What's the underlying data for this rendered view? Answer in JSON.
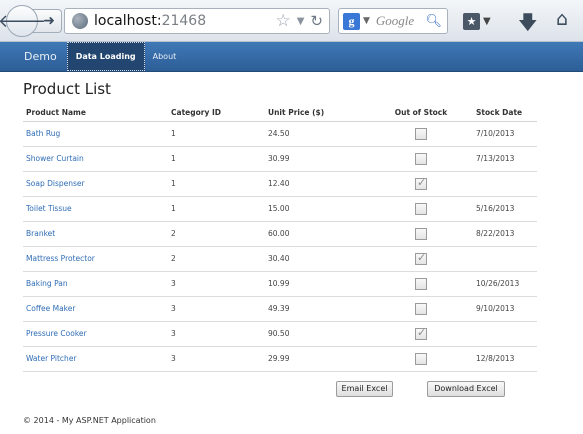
{
  "browser": {
    "url_host": "localhost:",
    "url_port": "21468",
    "search_placeholder": "Google",
    "icons": [
      "back-arrow-icon",
      "forward-arrow-icon",
      "globe-icon",
      "star-icon",
      "reload-icon",
      "google-icon",
      "search-icon",
      "bookmarks-icon",
      "download-icon",
      "home-icon"
    ]
  },
  "navbar": {
    "brand": "Demo",
    "links": [
      {
        "label": "Data Loading",
        "active": true
      },
      {
        "label": "About",
        "active": false
      }
    ]
  },
  "page": {
    "title": "Product List",
    "columns": [
      "Product Name",
      "Category ID",
      "Unit Price ($)",
      "Out of Stock",
      "Stock Date"
    ],
    "rows": [
      {
        "name": "Bath Rug",
        "category": "1",
        "price": "24.50",
        "out_of_stock": false,
        "date": "7/10/2013"
      },
      {
        "name": "Shower Curtain",
        "category": "1",
        "price": "30.99",
        "out_of_stock": false,
        "date": "7/13/2013"
      },
      {
        "name": "Soap Dispenser",
        "category": "1",
        "price": "12.40",
        "out_of_stock": true,
        "date": ""
      },
      {
        "name": "Toilet Tissue",
        "category": "1",
        "price": "15.00",
        "out_of_stock": false,
        "date": "5/16/2013"
      },
      {
        "name": "Branket",
        "category": "2",
        "price": "60.00",
        "out_of_stock": false,
        "date": "8/22/2013"
      },
      {
        "name": "Mattress Protector",
        "category": "2",
        "price": "30.40",
        "out_of_stock": true,
        "date": ""
      },
      {
        "name": "Baking Pan",
        "category": "3",
        "price": "10.99",
        "out_of_stock": false,
        "date": "10/26/2013"
      },
      {
        "name": "Coffee Maker",
        "category": "3",
        "price": "49.39",
        "out_of_stock": false,
        "date": "9/10/2013"
      },
      {
        "name": "Pressure Cooker",
        "category": "3",
        "price": "90.50",
        "out_of_stock": true,
        "date": ""
      },
      {
        "name": "Water Pitcher",
        "category": "3",
        "price": "29.99",
        "out_of_stock": false,
        "date": "12/8/2013"
      }
    ],
    "buttons": {
      "email": "Email Excel",
      "download": "Download Excel"
    },
    "footer": "© 2014 - My ASP.NET Application"
  },
  "colors": {
    "navbar": "#3f78b7",
    "link": "#2f6db5"
  }
}
